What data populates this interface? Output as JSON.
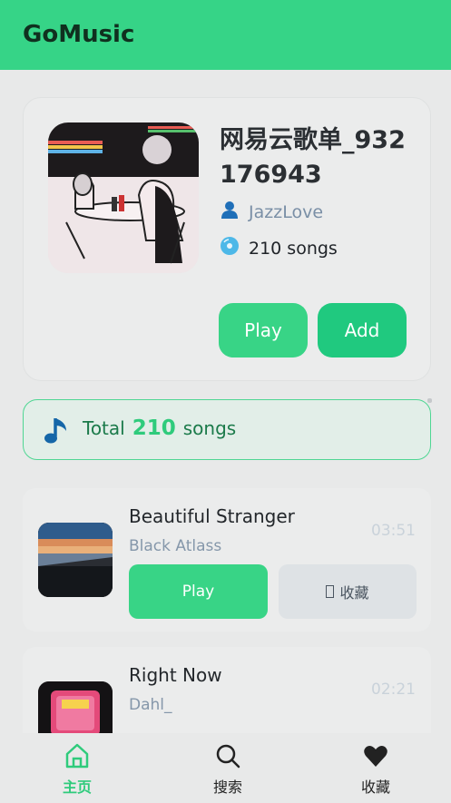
{
  "app": {
    "title": "GoMusic"
  },
  "playlist": {
    "title": "网易云歌单_932176943",
    "owner": "JazzLove",
    "song_count_label": "210 songs",
    "play_label": "Play",
    "add_label": "Add"
  },
  "total": {
    "prefix": "Total",
    "count": "210",
    "suffix": "songs"
  },
  "songs": [
    {
      "title": "Beautiful Stranger",
      "artist": "Black Atlass",
      "duration": "03:51",
      "play_label": "Play",
      "fav_label": "收藏"
    },
    {
      "title": "Right Now",
      "artist": "Dahl_",
      "duration": "02:21"
    }
  ],
  "tabs": {
    "home": "主页",
    "search": "搜索",
    "favorites": "收藏"
  },
  "colors": {
    "accent": "#36d487",
    "accent_dark": "#20c97f",
    "owner_text": "#7a8fa6"
  },
  "icons": {
    "owner": "user-icon",
    "count": "disc-icon",
    "total": "music-note-icon",
    "home": "home-icon",
    "search": "search-icon",
    "favorites": "heart-icon"
  }
}
